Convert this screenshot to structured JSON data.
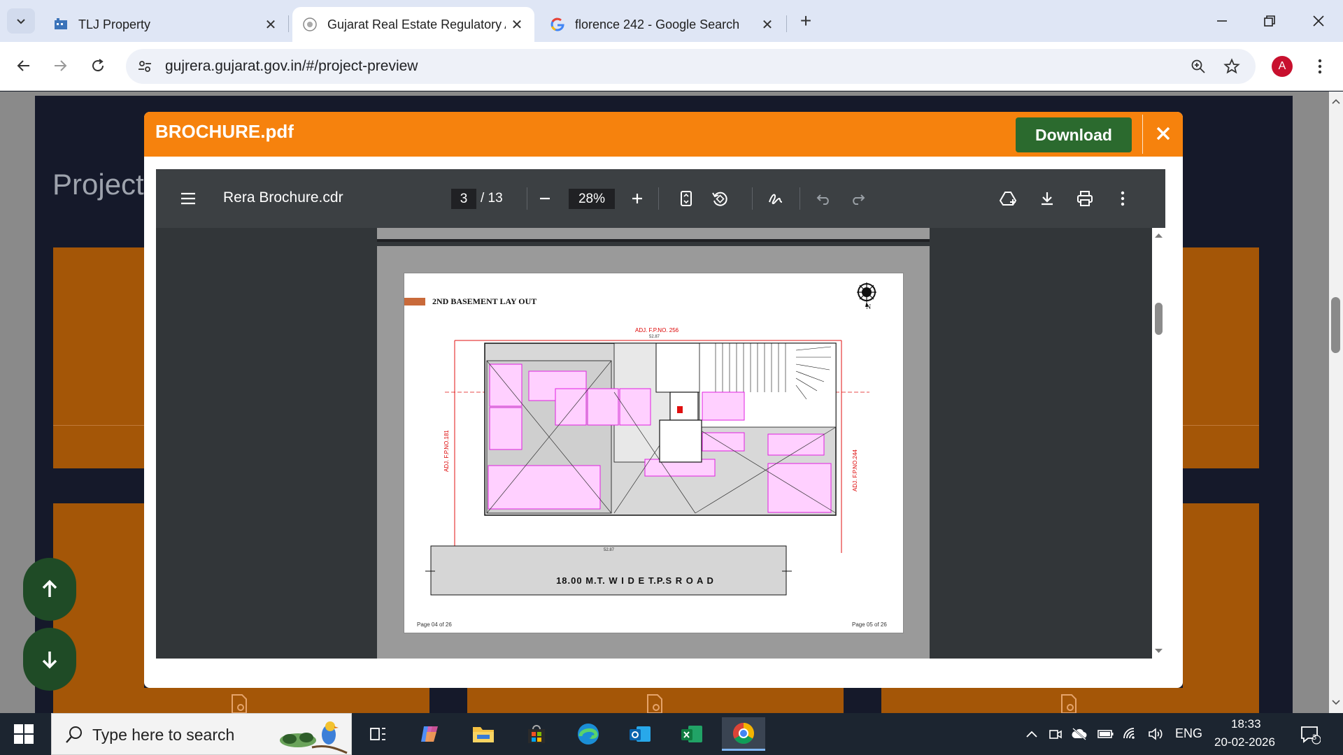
{
  "browser": {
    "tabs": [
      {
        "title": "TLJ Property"
      },
      {
        "title": "Gujarat Real Estate Regulatory A"
      },
      {
        "title": "florence 242 - Google Search"
      }
    ],
    "url": "gujrera.gujarat.gov.in/#/project-preview",
    "profile_initial": "A"
  },
  "page": {
    "title": "Project"
  },
  "modal": {
    "title": "BROCHURE.pdf",
    "download_label": "Download"
  },
  "pdf_viewer": {
    "document_name": "Rera Brochure.cdr",
    "current_page": "3",
    "total_pages": "/ 13",
    "zoom": "28%"
  },
  "drawing": {
    "heading": "2ND BASEMENT LAY OUT",
    "top_neighbor": "ADJ. F.P.NO. 256",
    "left_neighbor": "ADJ. F.P.NO.181",
    "right_neighbor": "ADJ. F.P.NO.244",
    "road": "18.00  M.T.  W I D E  T.P.S  R O A D",
    "dimension_top": "52.87",
    "dimension_bottom": "52.87",
    "north": "N",
    "page_left": "Page 04 of 26",
    "page_right": "Page 05 of 26"
  },
  "taskbar": {
    "search_placeholder": "Type here to search",
    "language": "ENG",
    "time": "18:33",
    "date": "20-02-2026",
    "notification_count": "3"
  }
}
